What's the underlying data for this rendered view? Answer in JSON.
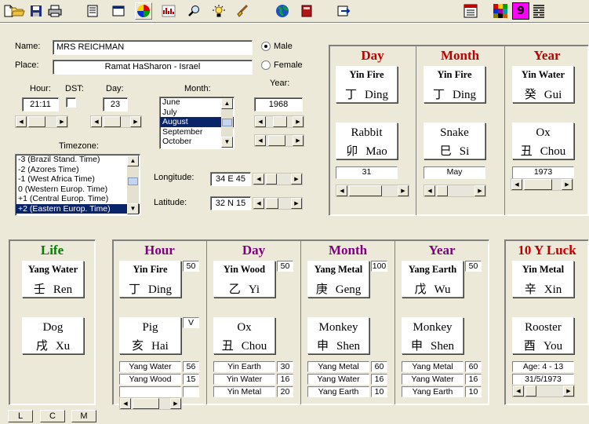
{
  "toolbar": {
    "icons": [
      "new-file-icon",
      "open-folder-icon",
      "save-icon",
      "print-icon",
      "properties-icon",
      "window-icon",
      "color-wheel-icon",
      "chart-icon",
      "search-icon",
      "light-icon",
      "brush-icon",
      "globe-icon",
      "book-icon",
      "export-icon",
      "calendar-icon",
      "grid-icon",
      "nine-icon",
      "hexagram-icon"
    ],
    "nine_label": "9"
  },
  "form": {
    "name_label": "Name:",
    "name_value": "MRS REICHMAN",
    "place_label": "Place:",
    "place_value": "Ramat HaSharon - Israel",
    "male_label": "Male",
    "female_label": "Female",
    "hour_label": "Hour:",
    "hour_value": "21:11",
    "dst_label": "DST:",
    "day_label": "Day:",
    "day_value": "23",
    "month_label": "Month:",
    "months": [
      "June",
      "July",
      "August",
      "September",
      "October"
    ],
    "year_label": "Year:",
    "year_value": "1968",
    "timezone_label": "Timezone:",
    "timezones": [
      "-3 (Brazil Stand.  Time)",
      "-2 (Azores Time)",
      "-1 (West Africa Time)",
      "0 (Western Europ. Time)",
      "+1 (Central Europ. Time)",
      "+2 (Eastern Europ. Time)"
    ],
    "longitude_label": "Longitude:",
    "longitude_value": "34 E 45",
    "latitude_label": "Latitude:",
    "latitude_value": "32 N 15"
  },
  "top_pillars": [
    {
      "title": "Day",
      "stem": "Yin Fire",
      "stem_char": "丁",
      "stem_name": "Ding",
      "branch": "Rabbit",
      "branch_char": "卯",
      "branch_name": "Mao",
      "value": "31"
    },
    {
      "title": "Month",
      "stem": "Yin Fire",
      "stem_char": "丁",
      "stem_name": "Ding",
      "branch": "Snake",
      "branch_char": "巳",
      "branch_name": "Si",
      "value": "May"
    },
    {
      "title": "Year",
      "stem": "Yin Water",
      "stem_char": "癸",
      "stem_name": "Gui",
      "branch": "Ox",
      "branch_char": "丑",
      "branch_name": "Chou",
      "value": "1973"
    }
  ],
  "life": {
    "title": "Life",
    "stem": "Yang Water",
    "stem_char": "壬",
    "stem_name": "Ren",
    "branch": "Dog",
    "branch_char": "戌",
    "branch_name": "Xu"
  },
  "bottom_pillars": [
    {
      "title": "Hour",
      "stem": "Yin Fire",
      "stem_char": "丁",
      "stem_name": "Ding",
      "stem_num": "50",
      "branch": "Pig",
      "branch_char": "亥",
      "branch_name": "Hai",
      "branch_num": "V",
      "hidden": [
        {
          "name": "Yang Water",
          "num": "56"
        },
        {
          "name": "Yang Wood",
          "num": "15"
        },
        {
          "name": "",
          "num": ""
        }
      ]
    },
    {
      "title": "Day",
      "stem": "Yin Wood",
      "stem_char": "乙",
      "stem_name": "Yi",
      "stem_num": "50",
      "branch": "Ox",
      "branch_char": "丑",
      "branch_name": "Chou",
      "branch_num": "",
      "hidden": [
        {
          "name": "Yin Earth",
          "num": "30"
        },
        {
          "name": "Yin Water",
          "num": "16"
        },
        {
          "name": "Yin Metal",
          "num": "20"
        }
      ]
    },
    {
      "title": "Month",
      "stem": "Yang Metal",
      "stem_char": "庚",
      "stem_name": "Geng",
      "stem_num": "100",
      "branch": "Monkey",
      "branch_char": "申",
      "branch_name": "Shen",
      "branch_num": "",
      "hidden": [
        {
          "name": "Yang Metal",
          "num": "60"
        },
        {
          "name": "Yang Water",
          "num": "16"
        },
        {
          "name": "Yang Earth",
          "num": "10"
        }
      ]
    },
    {
      "title": "Year",
      "stem": "Yang Earth",
      "stem_char": "戊",
      "stem_name": "Wu",
      "stem_num": "50",
      "branch": "Monkey",
      "branch_char": "申",
      "branch_name": "Shen",
      "branch_num": "",
      "hidden": [
        {
          "name": "Yang Metal",
          "num": "60"
        },
        {
          "name": "Yang Water",
          "num": "16"
        },
        {
          "name": "Yang Earth",
          "num": "10"
        }
      ]
    }
  ],
  "luck": {
    "title": "10 Y Luck",
    "stem": "Yin Metal",
    "stem_char": "辛",
    "stem_name": "Xin",
    "branch": "Rooster",
    "branch_char": "酉",
    "branch_name": "You",
    "age": "Age: 4 - 13",
    "date": "31/5/1973"
  },
  "buttons": {
    "l": "L",
    "c": "C",
    "m": "M"
  }
}
